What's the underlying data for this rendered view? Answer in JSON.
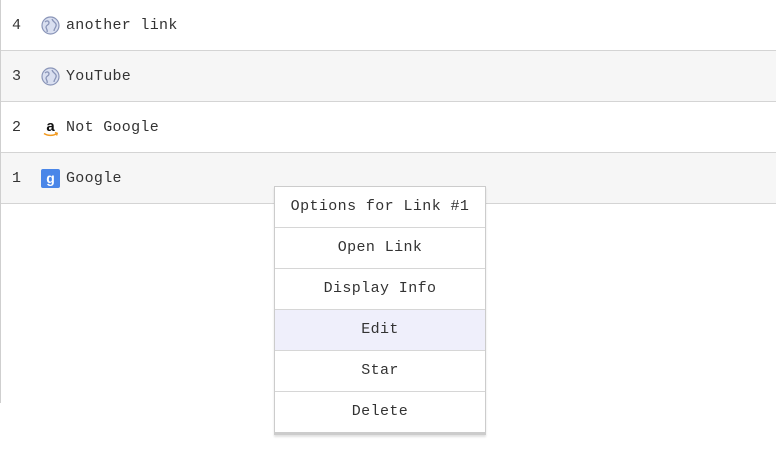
{
  "links": [
    {
      "number": "4",
      "label": "another link",
      "icon": "globe-icon"
    },
    {
      "number": "3",
      "label": "YouTube",
      "icon": "globe-icon"
    },
    {
      "number": "2",
      "label": "Not Google",
      "icon": "amazon-icon"
    },
    {
      "number": "1",
      "label": "Google",
      "icon": "google-icon"
    }
  ],
  "context_menu": {
    "title": "Options for Link #1",
    "items": [
      "Open Link",
      "Display Info",
      "Edit",
      "Star",
      "Delete"
    ],
    "highlighted": "Edit"
  },
  "colors": {
    "row_alt": "#f6f6f6",
    "menu_hover": "#efeffb",
    "google_blue": "#4a86e8",
    "globe": "#8a95b8"
  }
}
